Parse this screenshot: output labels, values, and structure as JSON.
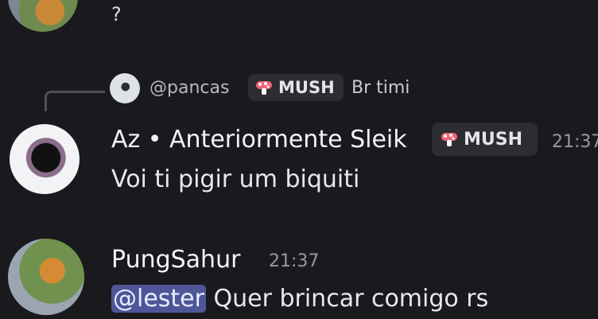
{
  "previous_message": {
    "text": "?"
  },
  "message_1": {
    "reply": {
      "username": "@pancas",
      "badge": "MUSH",
      "text": "Br timi"
    },
    "author": "Az • Anteriormente Sleik",
    "badge": "MUSH",
    "time": "21:37",
    "text": "Voi ti pigir um biquiti"
  },
  "message_2": {
    "author": "PungSahur",
    "time": "21:37",
    "mention": "@lester",
    "text": " Quer brincar comigo rs"
  },
  "colors": {
    "background": "#1a1a1e",
    "mention_bg": "#4e5698",
    "badge_bg": "#2b2d31",
    "timestamp": "#949ba4"
  },
  "icons": {
    "badge": "mushroom-icon"
  }
}
